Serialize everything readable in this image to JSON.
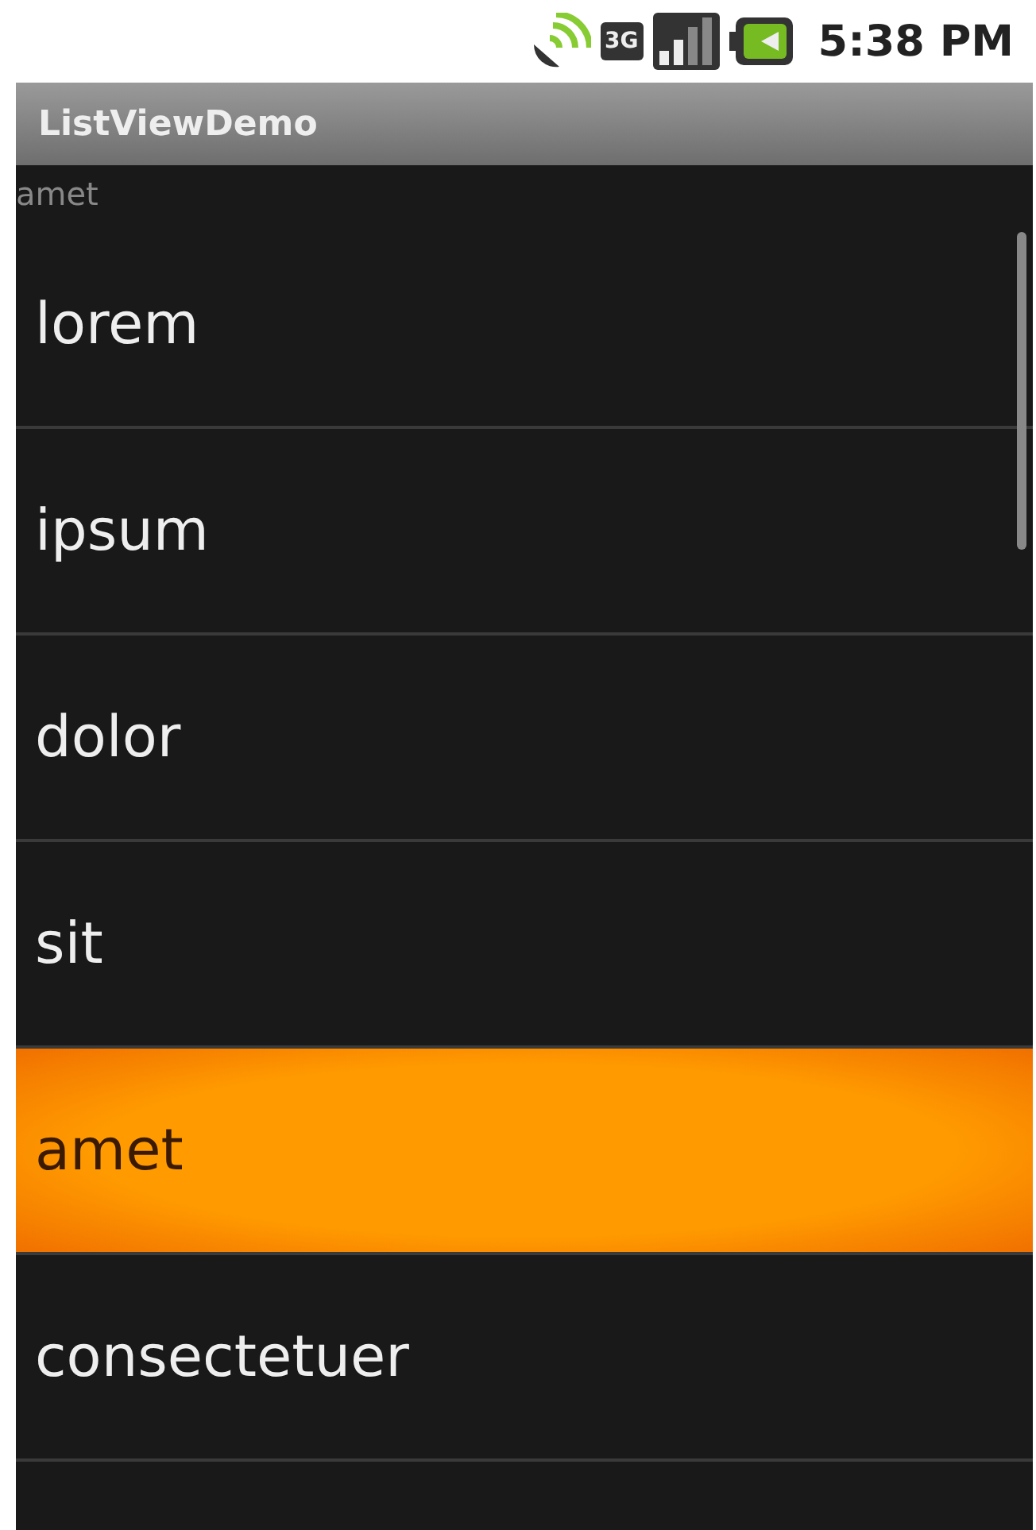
{
  "status_bar": {
    "time": "5:38 PM",
    "network": "3G"
  },
  "window": {
    "title": "ListViewDemo"
  },
  "selection": "amet",
  "items": [
    {
      "label": "lorem",
      "selected": false
    },
    {
      "label": "ipsum",
      "selected": false
    },
    {
      "label": "dolor",
      "selected": false
    },
    {
      "label": "sit",
      "selected": false
    },
    {
      "label": "amet",
      "selected": true
    },
    {
      "label": "consectetuer",
      "selected": false
    }
  ]
}
